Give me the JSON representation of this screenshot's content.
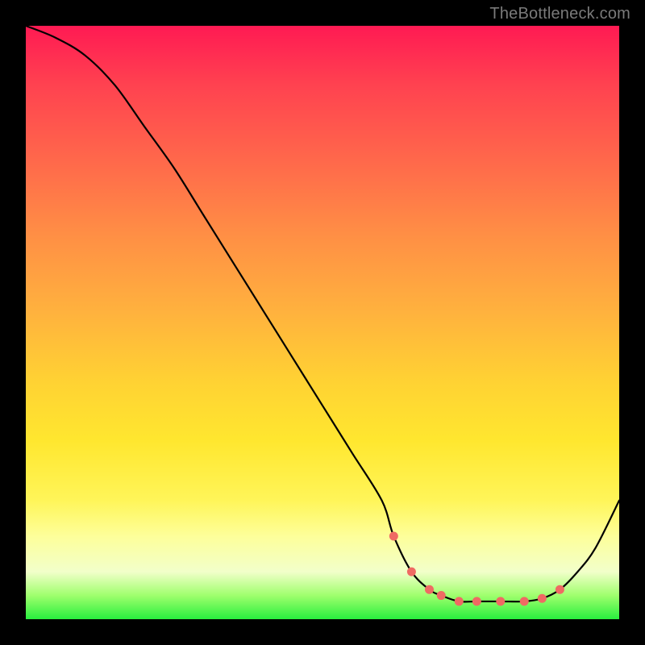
{
  "watermark": "TheBottleneck.com",
  "chart_data": {
    "type": "line",
    "title": "",
    "xlabel": "",
    "ylabel": "",
    "xlim": [
      0,
      100
    ],
    "ylim": [
      0,
      100
    ],
    "series": [
      {
        "name": "bottleneck-curve",
        "x": [
          0,
          5,
          10,
          15,
          20,
          25,
          30,
          35,
          40,
          45,
          50,
          55,
          60,
          62,
          65,
          68,
          70,
          73,
          76,
          80,
          84,
          87,
          90,
          93,
          96,
          100
        ],
        "values": [
          100,
          98,
          95,
          90,
          83,
          76,
          68,
          60,
          52,
          44,
          36,
          28,
          20,
          14,
          8,
          5,
          4,
          3,
          3,
          3,
          3,
          3.5,
          5,
          8,
          12,
          20
        ]
      }
    ],
    "markers": {
      "name": "highlight-dots",
      "x": [
        62,
        65,
        68,
        70,
        73,
        76,
        80,
        84,
        87,
        90
      ],
      "values": [
        14,
        8,
        5,
        4,
        3,
        3,
        3,
        3,
        3.5,
        5
      ]
    }
  }
}
